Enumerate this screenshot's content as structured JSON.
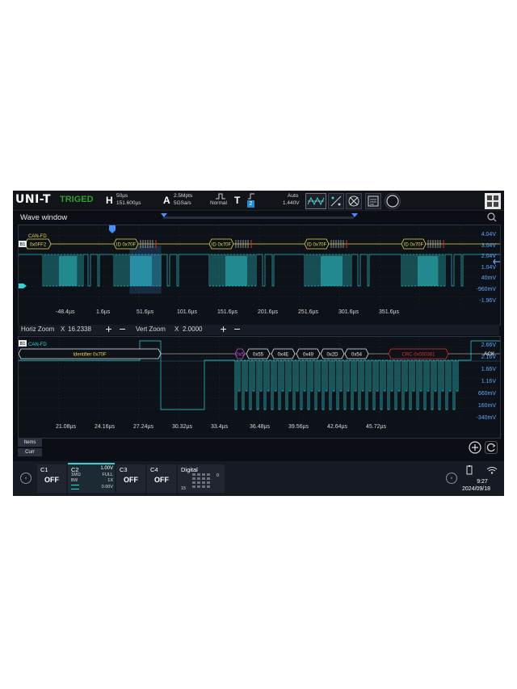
{
  "brand": {
    "logo": "UNI-T",
    "trigger_state": "TRIGED"
  },
  "topbar": {
    "horizontal": {
      "key": "H",
      "scale": "50µs",
      "offset": "151.600µs"
    },
    "acquire": {
      "key": "A",
      "points": "2.5Mpts",
      "rate": "5GSa/s",
      "mode": "Normal"
    },
    "trigger": {
      "key": "T",
      "source": "2",
      "mode": "Auto",
      "level": "1.440V"
    }
  },
  "wave_window": {
    "title": "Wave window"
  },
  "overview": {
    "bus_label": "CAN-FD",
    "bus_tag": "B1",
    "first_frame": "0x0FF2",
    "frames": [
      "ID 0x70F",
      "ID 0x70F",
      "ID 0x70F",
      "ID 0x70F"
    ],
    "time_labels": [
      "-48.4µs",
      "1.6µs",
      "51.6µs",
      "101.6µs",
      "151.6µs",
      "201.6µs",
      "251.6µs",
      "301.6µs",
      "351.6µs"
    ],
    "volt_labels": [
      "4.04V",
      "3.04V",
      "2.04V",
      "1.04V",
      "40mV",
      "-960mV",
      "-1.96V"
    ]
  },
  "zoom": {
    "horiz_label": "Horiz Zoom",
    "horiz_x": "X",
    "horiz_value": "16.2338",
    "vert_label": "Vert Zoom",
    "vert_x": "X",
    "vert_value": "2.0000",
    "plus": "+",
    "minus": "−"
  },
  "detail": {
    "bus_label": "CAN-FD",
    "bus_tag": "B1",
    "identifier": "Identifier 0x70F",
    "dlc": "0x5",
    "bytes": [
      "0x55",
      "0x4E",
      "0x49",
      "0x2D",
      "0x54"
    ],
    "crc": "CRC 0x000381",
    "ack": "ACK",
    "time_labels": [
      "21.08µs",
      "24.16µs",
      "27.24µs",
      "30.32µs",
      "33.4µs",
      "36.48µs",
      "39.56µs",
      "42.64µs",
      "45.72µs"
    ],
    "volt_labels": [
      "2.66V",
      "2.16V",
      "1.66V",
      "1.16V",
      "660mV",
      "160mV",
      "-340mV"
    ]
  },
  "items": {
    "items_label": "Items",
    "curr_label": "Curr"
  },
  "channels": [
    {
      "name": "C1",
      "state": "OFF"
    },
    {
      "name": "C2",
      "scale": "1.00V",
      "impedance": "1MΩ",
      "bandwidth": "FULL",
      "bw_label": "BW",
      "probe": "1X",
      "offset": "0.00V"
    },
    {
      "name": "C3",
      "state": "OFF"
    },
    {
      "name": "C4",
      "state": "OFF"
    }
  ],
  "digital": {
    "name": "Digital",
    "top": "0",
    "bottom": "15"
  },
  "status": {
    "time": "9:27",
    "date": "2024/09/18"
  },
  "colors": {
    "accent": "#2fd3d8",
    "bus_yellow": "#e8d84a",
    "crc_red": "#e0302c",
    "dlc_magenta": "#d24fd4",
    "volt_blue": "#5fa8ff"
  }
}
